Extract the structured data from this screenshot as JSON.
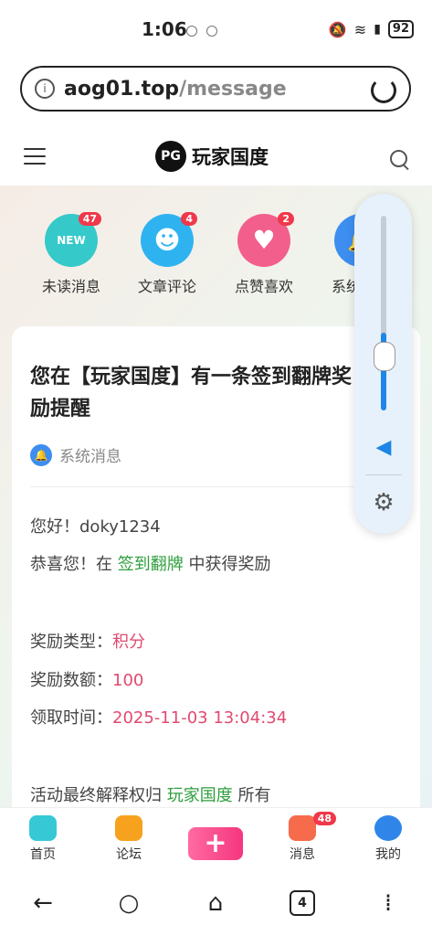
{
  "status": {
    "time": "1:06",
    "battery": "92"
  },
  "browser": {
    "url_host": "aog01.top",
    "url_path": "/message"
  },
  "site": {
    "logo_mark": "PG",
    "logo_text": "玩家国度"
  },
  "categories": [
    {
      "label": "未读消息",
      "badge": "47",
      "icon": "new-icon",
      "badge_text": "NEW",
      "color": "#35c9c9"
    },
    {
      "label": "文章评论",
      "badge": "4",
      "icon": "chat-face-icon",
      "color": "#2fb3f0"
    },
    {
      "label": "点赞喜欢",
      "badge": "2",
      "icon": "heart-icon",
      "color": "#f25f8c"
    },
    {
      "label": "系统通知",
      "icon": "bell-icon",
      "color": "#3d8ef0"
    }
  ],
  "message": {
    "title": "您在【玩家国度】有一条签到翻牌奖励提醒",
    "tag": "系统消息",
    "greeting": "您好！doky1234",
    "congrats_prefix": "恭喜您！在",
    "congrats_link": "签到翻牌",
    "congrats_suffix": "中获得奖励",
    "reward_type_label": "奖励类型：",
    "reward_type_value": "积分",
    "reward_amount_label": "奖励数额：",
    "reward_amount_value": "100",
    "claim_time_label": "领取时间：",
    "claim_time_value": "2025-11-03 13:04:34",
    "footer_prefix": "活动最终解释权归",
    "footer_link": "玩家国度",
    "footer_suffix": "所有"
  },
  "volume": {
    "level": 0.4
  },
  "nav": [
    {
      "label": "首页",
      "icon": "home-icon"
    },
    {
      "label": "论坛",
      "icon": "forum-icon"
    },
    {
      "label": "消息",
      "icon": "message-bell-icon",
      "badge": "48"
    },
    {
      "label": "我的",
      "icon": "profile-icon"
    }
  ],
  "plus_label": "+",
  "system_nav": {
    "tabs_count": "4"
  }
}
